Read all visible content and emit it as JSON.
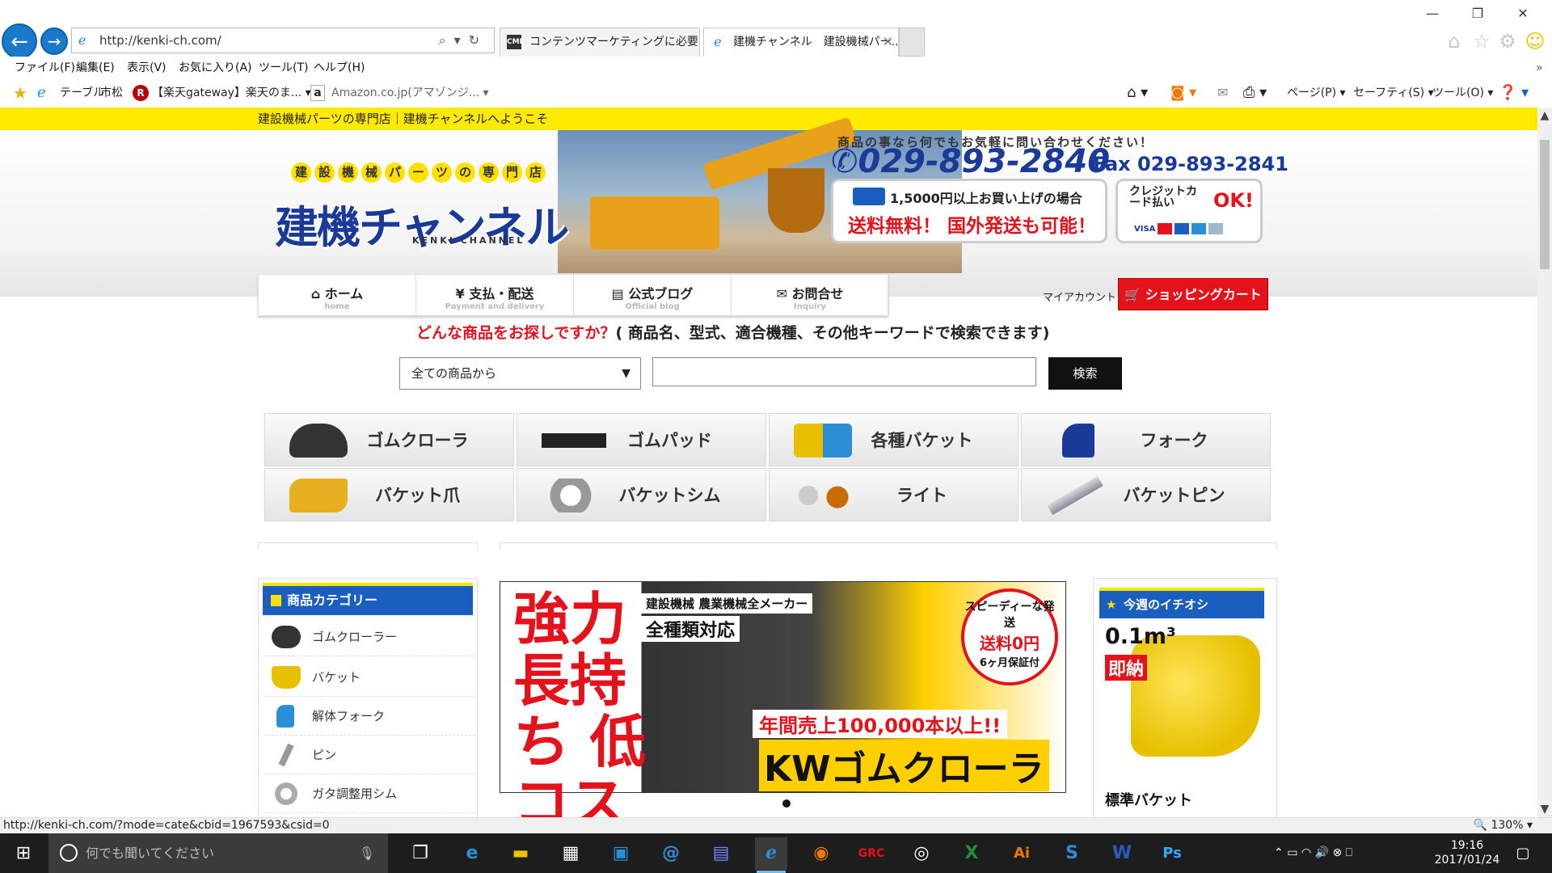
{
  "browser": {
    "address": "http://kenki-ch.com/",
    "tabs": [
      {
        "label": "コンテンツマーケティングに必要なSE...",
        "icon": "cml-site-icon"
      },
      {
        "label": "建機チャンネル　建設機械パー...",
        "icon": "ie-page-icon"
      }
    ],
    "menu": [
      "ファイル(F)",
      "編集(E)",
      "表示(V)",
      "お気に入り(A)",
      "ツール(T)",
      "ヘルプ(H)"
    ],
    "favorites": [
      "テーブル",
      "市松",
      "【楽天gateway】楽天のま...",
      "Amazon.co.jp(アマゾンジ..."
    ],
    "command_bar": [
      "ページ(P)",
      "セーフティ(S)",
      "ツール(O)"
    ],
    "status_url": "http://kenki-ch.com/?mode=cate&cbid=1967593&csid=0",
    "zoom": "130%"
  },
  "site": {
    "welcome": "建設機械パーツの専門店｜建機チャンネルへようこそ",
    "logo_tagline": [
      "建",
      "設",
      "機",
      "械",
      "パ",
      "ー",
      "ツ",
      "の",
      "専",
      "門",
      "店"
    ],
    "logo_name": "建機チャンネル",
    "logo_sub": "KENKI CHANNEL",
    "contact_lead": "商品の事なら何でもお気軽に問い合わせください！",
    "tel": "029-893-2840",
    "fax": "Fax 029-893-2841",
    "ship_line1": "1,5000円以上お買い上げの場合",
    "ship_line2": "送料無料！ 国外発送も可能！",
    "card_line1": "クレジットカード払い",
    "card_ok": "OK!",
    "card_brands": "VISA",
    "nav": [
      {
        "label": "ホーム",
        "sub": "home",
        "icon": "home-icon",
        "glyph": "⌂"
      },
      {
        "label": "支払・配送",
        "sub": "Payment and delivery",
        "icon": "yen-icon",
        "glyph": "¥"
      },
      {
        "label": "公式ブログ",
        "sub": "Official blog",
        "icon": "blog-icon",
        "glyph": "▤"
      },
      {
        "label": "お問合せ",
        "sub": "Inquiry",
        "icon": "mail-icon",
        "glyph": "✉"
      }
    ],
    "my_account": "マイアカウント",
    "cart": "ショッピングカート",
    "search_question_red": "どんな商品をお探しですか？",
    "search_question_rest": "( 商品名、型式、適合機種、その他キーワードで検索できます)",
    "search_select": "全ての商品から",
    "search_button": "検索",
    "categories": [
      "ゴムクローラ",
      "ゴムパッド",
      "各種バケット",
      "フォーク",
      "バケット爪",
      "バケットシム",
      "ライト",
      "バケットピン"
    ],
    "sidebar_title": "商品カテゴリー",
    "sidebar_items": [
      "ゴムクローラー",
      "バケット",
      "解体フォーク",
      "ピン",
      "ガタ調整用シム"
    ],
    "banner": {
      "headline": "強力 長持ち 低コスト",
      "tag1": "建設機械 農業機械全メーカー",
      "tag2": "全種類対応",
      "circle1": "スピーディーな発送",
      "circle2": "送料0円",
      "circle3": "6ヶ月保証付",
      "sales": "年間売上100,000本以上!!",
      "product": "KWゴムクローラ"
    },
    "pick": {
      "title": "今週のイチオシ",
      "volume": "0.1m³",
      "badge": "即納",
      "name": "標準バケット"
    }
  },
  "taskbar": {
    "search_placeholder": "何でも聞いてください",
    "time": "19:16",
    "date": "2017/01/24"
  },
  "colors": {
    "yellow": "#ffea00",
    "red": "#e6121b",
    "blue": "#1a3a9a",
    "ie_blue": "#1979ca"
  }
}
